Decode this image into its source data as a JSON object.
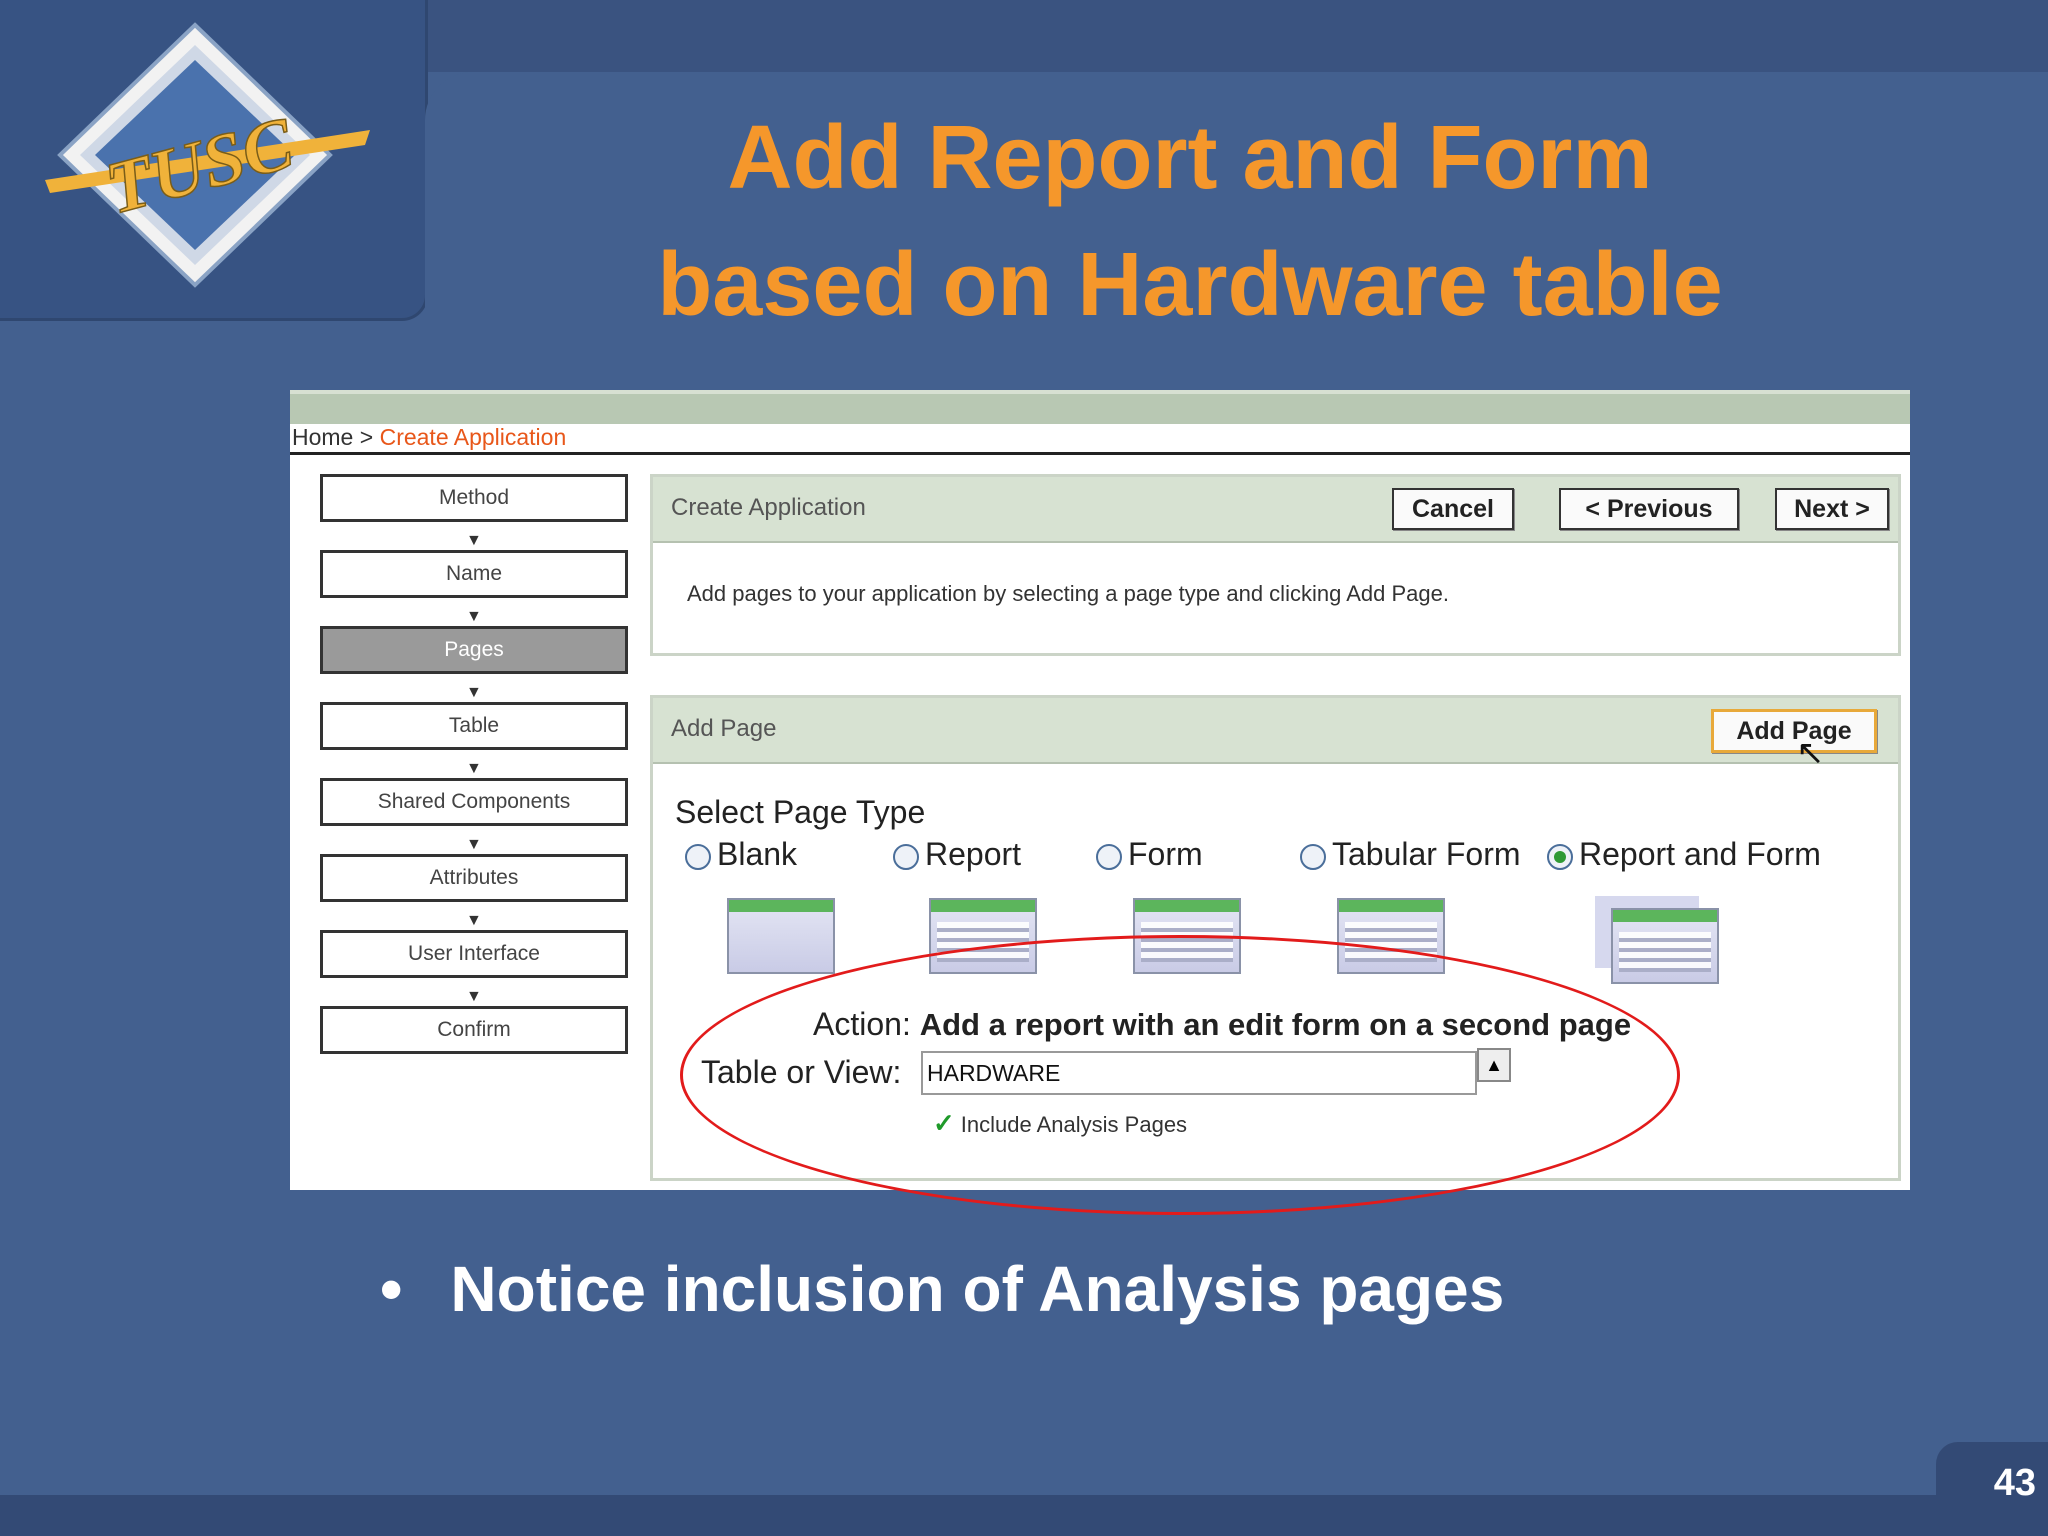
{
  "slide": {
    "title_line1": "Add Report and Form",
    "title_line2": "based on Hardware table",
    "bullet": "Notice inclusion of Analysis pages",
    "page_number": "43",
    "logo_text": "TUSC"
  },
  "app": {
    "breadcrumb": {
      "home": "Home >",
      "current": "Create Application"
    },
    "steps": [
      "Method",
      "Name",
      "Pages",
      "Table",
      "Shared Components",
      "Attributes",
      "User Interface",
      "Confirm"
    ],
    "active_step": "Pages",
    "create_region": {
      "title": "Create Application",
      "cancel": "Cancel",
      "previous": "< Previous",
      "next": "Next >",
      "instruction": "Add pages to your application by selecting a page type and clicking Add Page."
    },
    "add_page_region": {
      "title": "Add Page",
      "add_button": "Add Page",
      "select_label": "Select Page Type",
      "page_types": [
        "Blank",
        "Report",
        "Form",
        "Tabular Form",
        "Report and Form"
      ],
      "selected_type": "Report and Form",
      "action_label": "Action:",
      "action_text": "Add a report with an edit form on a second page",
      "table_label": "Table or View:",
      "table_value": "HARDWARE",
      "include_analysis": "Include Analysis Pages",
      "include_checked": true
    }
  },
  "colors": {
    "background": "#43608f",
    "title": "#f5972b",
    "highlight": "#e21b1b"
  }
}
